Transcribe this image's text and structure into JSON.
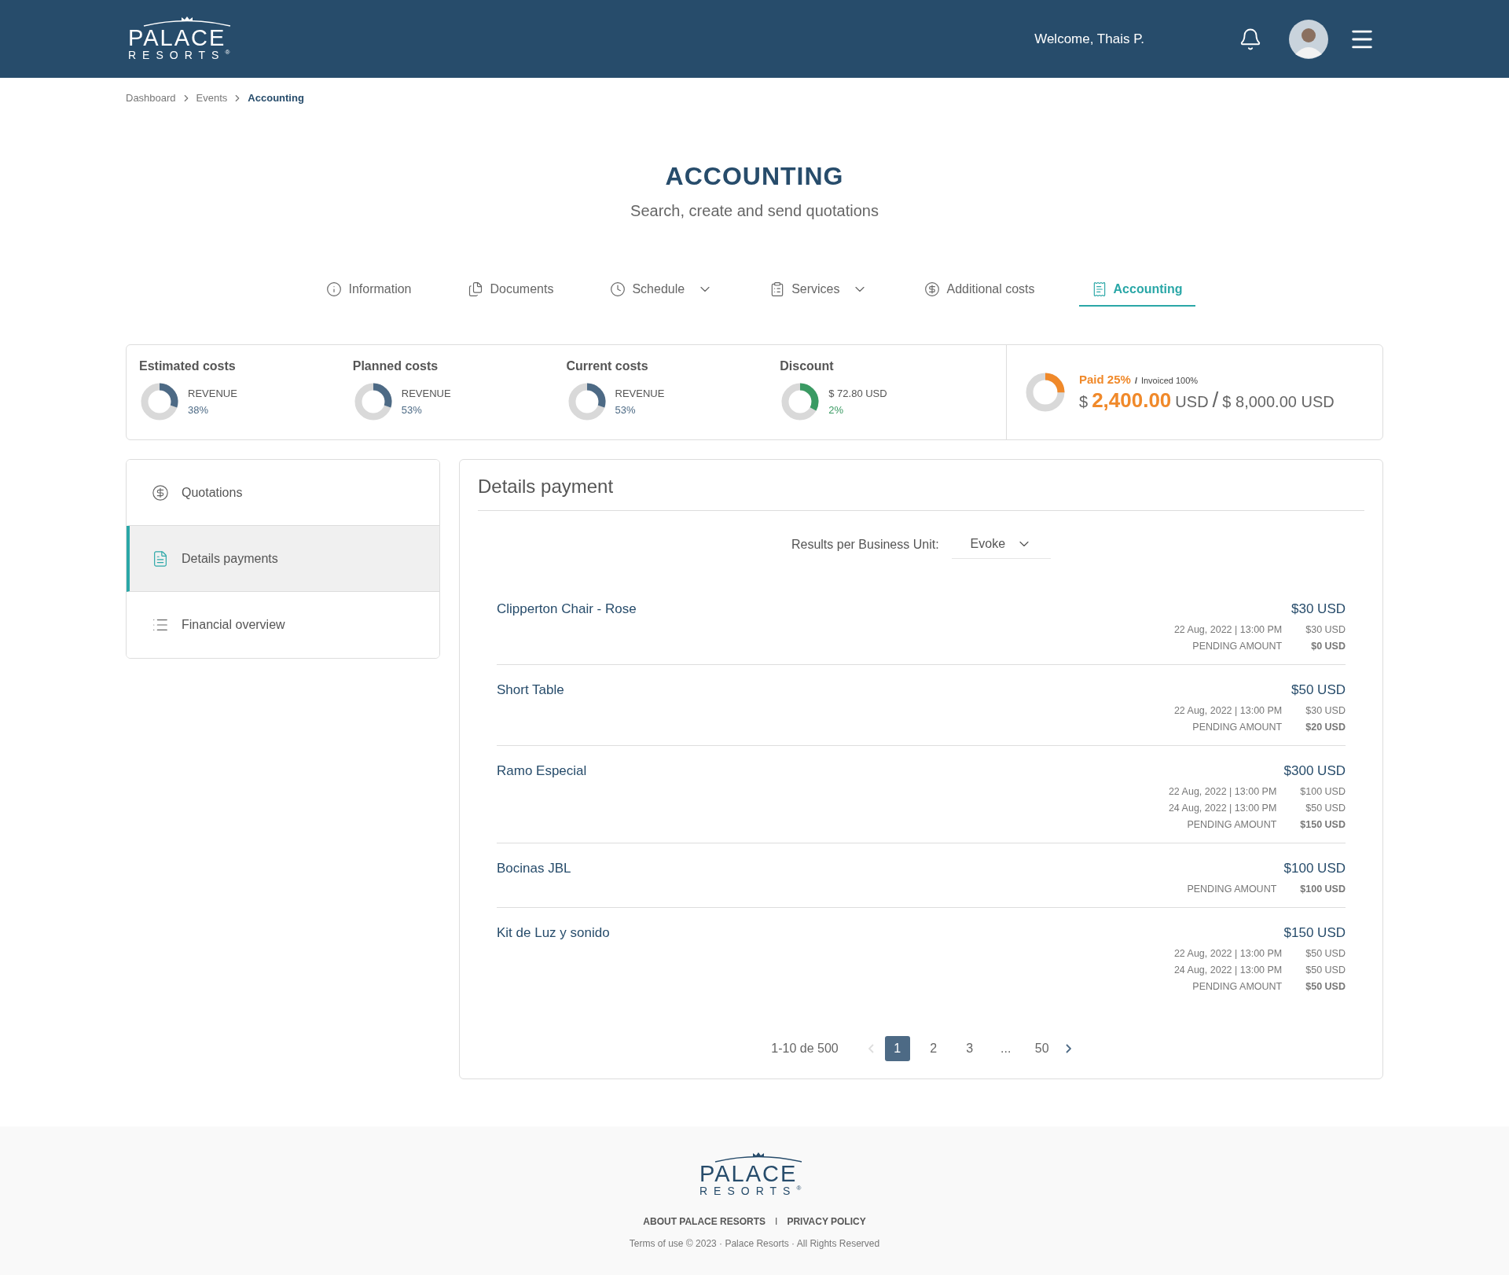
{
  "header": {
    "logo": {
      "name": "PALACE",
      "sub": "RESORTS",
      "mark": "®"
    },
    "welcome": "Welcome, Thais P."
  },
  "breadcrumb": [
    {
      "label": "Dashboard",
      "current": false
    },
    {
      "label": "Events",
      "current": false
    },
    {
      "label": "Accounting",
      "current": true
    }
  ],
  "page": {
    "title": "ACCOUNTING",
    "subtitle": "Search, create and send quotations"
  },
  "tabs": [
    {
      "label": "Information",
      "dropdown": false,
      "selected": false
    },
    {
      "label": "Documents",
      "dropdown": false,
      "selected": false
    },
    {
      "label": "Schedule",
      "dropdown": true,
      "selected": false
    },
    {
      "label": "Services",
      "dropdown": true,
      "selected": false
    },
    {
      "label": "Additional costs",
      "dropdown": false,
      "selected": false
    },
    {
      "label": "Accounting",
      "dropdown": false,
      "selected": true
    }
  ],
  "summary": {
    "costs": [
      {
        "title": "Estimated costs",
        "label": "REVENUE",
        "value": "38%",
        "level": 0.3,
        "color": "#4d6a85"
      },
      {
        "title": "Planned costs",
        "label": "REVENUE",
        "value": "53%",
        "level": 0.3,
        "color": "#4d6a85"
      },
      {
        "title": "Current costs",
        "label": "REVENUE",
        "value": "53%",
        "level": 0.3,
        "color": "#4d6a85"
      },
      {
        "title": "Discount",
        "label": "$ 72.80 USD",
        "value": "2%",
        "level": 0.33,
        "color": "#3a9a63"
      }
    ],
    "paid": {
      "paid": "Paid 25%",
      "slash": "/",
      "invoiced": "Invoiced 100%",
      "currency": "$",
      "amount": "2,400.00",
      "unit": "USD",
      "divider": "/",
      "total": "$ 8,000.00 USD",
      "level": 0.25
    }
  },
  "sidebar": {
    "items": [
      {
        "label": "Quotations",
        "selected": false
      },
      {
        "label": "Details payments",
        "selected": true
      },
      {
        "label": "Financial overview",
        "selected": false
      }
    ]
  },
  "details": {
    "title": "Details payment",
    "filter_label": "Results per Business Unit:",
    "filter_value": "Evoke",
    "items": [
      {
        "name": "Clipperton Chair - Rose",
        "total": "$30 USD",
        "payments": [
          {
            "date": "22 Aug, 2022 | 13:00 PM",
            "amount": "$30 USD"
          }
        ],
        "pending_label": "PENDING AMOUNT",
        "pending": "$0 USD"
      },
      {
        "name": "Short Table",
        "total": "$50 USD",
        "payments": [
          {
            "date": "22 Aug, 2022 | 13:00 PM",
            "amount": "$30 USD"
          }
        ],
        "pending_label": "PENDING AMOUNT",
        "pending": "$20 USD"
      },
      {
        "name": "Ramo Especial",
        "total": "$300 USD",
        "payments": [
          {
            "date": "22 Aug, 2022 | 13:00 PM",
            "amount": "$100 USD"
          },
          {
            "date": "24 Aug, 2022 | 13:00 PM",
            "amount": "$50 USD"
          }
        ],
        "pending_label": "PENDING AMOUNT",
        "pending": "$150 USD"
      },
      {
        "name": "Bocinas JBL",
        "total": "$100 USD",
        "pending_label": "PENDING AMOUNT",
        "pending": "$100 USD"
      },
      {
        "name": "Kit de Luz y sonido",
        "total": "$150 USD",
        "payments": [
          {
            "date": "22 Aug, 2022 | 13:00 PM",
            "amount": "$50 USD"
          },
          {
            "date": "24 Aug, 2022 | 13:00 PM",
            "amount": "$50 USD"
          }
        ],
        "pending_label": "PENDING AMOUNT",
        "pending": "$50 USD"
      }
    ],
    "pagination": {
      "range": "1-10 de 500",
      "prev_disabled": true,
      "next_disabled": false,
      "pages": [
        {
          "label": "1",
          "selected": true
        },
        {
          "label": "2",
          "selected": false
        },
        {
          "label": "3",
          "selected": false
        },
        {
          "label": "...",
          "selected": false
        },
        {
          "label": "50",
          "selected": false
        }
      ]
    }
  },
  "footer": {
    "logo": {
      "name": "PALACE",
      "sub": "RESORTS",
      "mark": "®"
    },
    "links": [
      "ABOUT PALACE RESORTS",
      "PRIVACY POLICY"
    ],
    "separator": "I",
    "copyright": "Terms of use © 2023 · Palace Resorts · All Rights Reserved"
  }
}
